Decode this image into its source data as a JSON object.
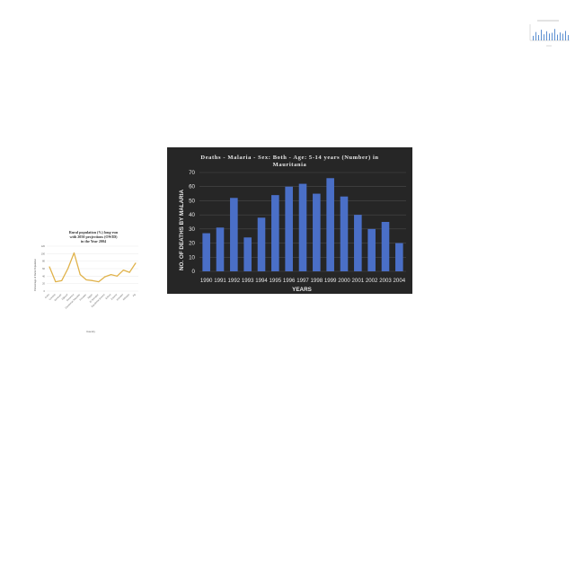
{
  "chart_data": [
    {
      "type": "bar",
      "title": "Deaths - Malaria - Sex: Both - Age: 5-14 years (Number) in Mauritania",
      "xlabel": "YEARS",
      "ylabel": "NO. OF DEATHS BY MALARIA",
      "categories": [
        "1990",
        "1991",
        "1992",
        "1993",
        "1994",
        "1995",
        "1996",
        "1997",
        "1998",
        "1999",
        "2000",
        "2001",
        "2002",
        "2003",
        "2004"
      ],
      "values": [
        27,
        31,
        52,
        24,
        38,
        54,
        60,
        62,
        55,
        66,
        53,
        40,
        30,
        35,
        20
      ],
      "ylim": [
        0,
        70
      ],
      "yticks": [
        0,
        10,
        20,
        30,
        40,
        50,
        60,
        70
      ],
      "grid": true,
      "legend": "none",
      "colors": {
        "background": "#262626",
        "bar": "#4a6fc7",
        "text": "#e8e8e8",
        "grid": "#4a4a4a"
      }
    },
    {
      "type": "line",
      "title": "Rural population (%) long-run with 2050 projections (OWID) in the Year 2004",
      "xlabel": "Country",
      "ylabel": "Percentage of Rural Population",
      "categories": [
        "Cuba",
        "Czechia",
        "Denmark",
        "Djibouti",
        "Dominica",
        "Dominican Republic",
        "Ecuador",
        "Egypt",
        "El Salvador",
        "Equatorial Guinea",
        "Eritrea",
        "Estonia",
        "Eswatini",
        "Ethiopia",
        "Fiji"
      ],
      "values": [
        65,
        25,
        28,
        60,
        102,
        44,
        30,
        28,
        25,
        38,
        44,
        40,
        56,
        50,
        75
      ],
      "ylim": [
        0,
        120
      ],
      "yticks": [
        0,
        20,
        40,
        60,
        80,
        100,
        120
      ],
      "grid": true,
      "legend": "none",
      "colors": {
        "line": "#e0b24a",
        "axis": "#999999",
        "grid": "#e4e4e4"
      }
    },
    {
      "type": "bar",
      "title": "",
      "categories": [
        "a",
        "b",
        "c",
        "d",
        "e",
        "f",
        "g",
        "h",
        "i",
        "j",
        "k",
        "l",
        "m",
        "n"
      ],
      "values": [
        30,
        55,
        35,
        70,
        40,
        60,
        45,
        50,
        75,
        38,
        52,
        44,
        62,
        35
      ],
      "ylim": [
        0,
        100
      ],
      "legend": "none",
      "colors": {
        "bar": "#5b8fd1",
        "axis": "#aaaaaa"
      }
    }
  ]
}
